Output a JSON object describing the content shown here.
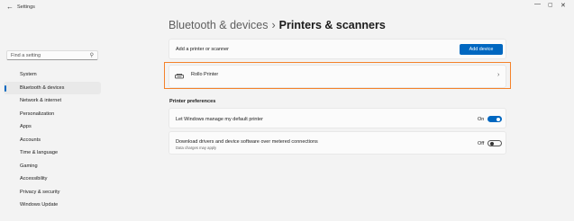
{
  "window": {
    "title": "Settings",
    "back_glyph": "←",
    "minimize_glyph": "—",
    "maximize_glyph": "▢",
    "close_glyph": "✕"
  },
  "search": {
    "placeholder": "Find a setting",
    "icon": "search-icon",
    "icon_glyph": "⚲"
  },
  "sidebar": {
    "items": [
      {
        "label": "System"
      },
      {
        "label": "Bluetooth & devices",
        "selected": true
      },
      {
        "label": "Network & internet"
      },
      {
        "label": "Personalization"
      },
      {
        "label": "Apps"
      },
      {
        "label": "Accounts"
      },
      {
        "label": "Time & language"
      },
      {
        "label": "Gaming"
      },
      {
        "label": "Accessibility"
      },
      {
        "label": "Privacy & security"
      },
      {
        "label": "Windows Update"
      }
    ]
  },
  "header": {
    "parent": "Bluetooth & devices",
    "separator": "›",
    "current": "Printers & scanners"
  },
  "add_printer": {
    "label": "Add a printer or scanner",
    "button_label": "Add device"
  },
  "printers": [
    {
      "name": "Rollo Printer",
      "icon": "printer-icon",
      "chevron": "›"
    }
  ],
  "preferences": {
    "title": "Printer preferences",
    "default_printer": {
      "label": "Let Windows manage my default printer",
      "state_text": "On",
      "on": true
    },
    "metered": {
      "label": "Download drivers and device software over metered connections",
      "sublabel": "Data charges may apply",
      "state_text": "Off",
      "on": false
    }
  },
  "colors": {
    "accent": "#0067c0",
    "highlight": "#f4822a",
    "background": "#f3f3f3",
    "card": "#fbfbfb"
  }
}
